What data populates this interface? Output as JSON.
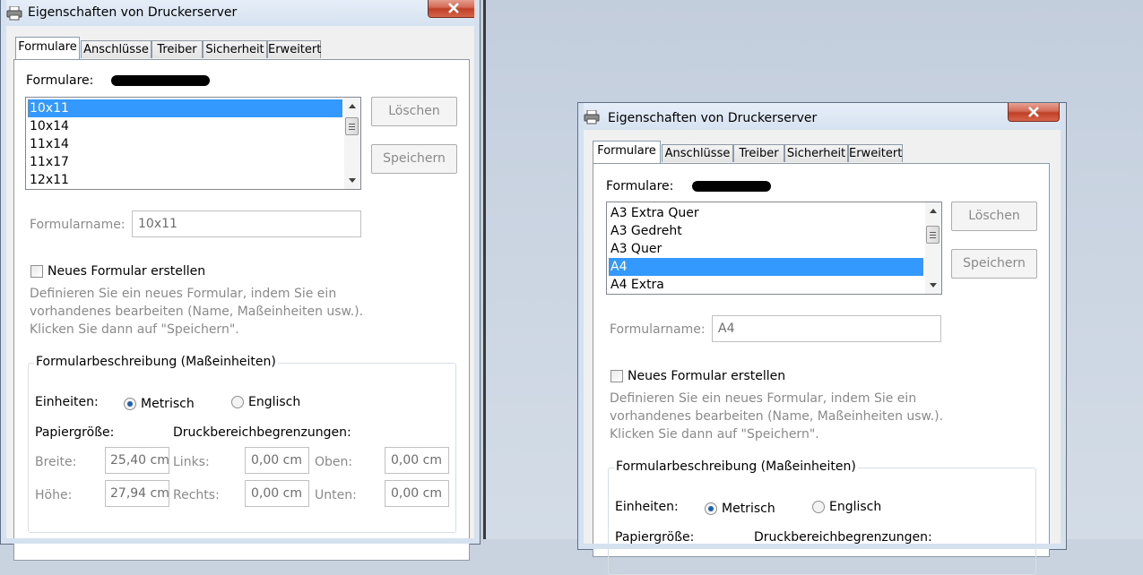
{
  "dialogs": [
    {
      "title": "Eigenschaften von Druckerserver",
      "tabs": [
        "Formulare",
        "Anschlüsse",
        "Treiber",
        "Sicherheit",
        "Erweitert"
      ],
      "active_tab": "Formulare",
      "forms_label": "Formulare:",
      "list_items": [
        "10x11",
        "10x14",
        "11x14",
        "11x17",
        "12x11"
      ],
      "selected_item": "10x11",
      "delete_label": "Löschen",
      "save_label": "Speichern",
      "form_name_label": "Formularname:",
      "form_name_value": "10x11",
      "new_form_label": "Neues Formular erstellen",
      "description": [
        "Definieren Sie ein neues Formular, indem Sie ein",
        "vorhandenes bearbeiten (Name, Maßeinheiten usw.).",
        "Klicken Sie dann auf \"Speichern\"."
      ],
      "group_label": "Formularbeschreibung (Maßeinheiten)",
      "units_label": "Einheiten:",
      "metric_label": "Metrisch",
      "english_label": "Englisch",
      "paper_size_label": "Papiergröße:",
      "print_area_label": "Druckbereichbegrenzungen:",
      "width_label": "Breite:",
      "width_value": "25,40 cm",
      "height_label": "Höhe:",
      "height_value": "27,94 cm",
      "left_label": "Links:",
      "left_value": "0,00 cm",
      "right_label": "Rechts:",
      "right_value": "0,00 cm",
      "top_label": "Oben:",
      "top_value": "0,00 cm",
      "bottom_label": "Unten:",
      "bottom_value": "0,00 cm"
    },
    {
      "title": "Eigenschaften von Druckerserver",
      "tabs": [
        "Formulare",
        "Anschlüsse",
        "Treiber",
        "Sicherheit",
        "Erweitert"
      ],
      "active_tab": "Formulare",
      "forms_label": "Formulare:",
      "list_items": [
        "A3 Extra Quer",
        "A3 Gedreht",
        "A3 Quer",
        "A4",
        "A4 Extra"
      ],
      "selected_item": "A4",
      "delete_label": "Löschen",
      "save_label": "Speichern",
      "form_name_label": "Formularname:",
      "form_name_value": "A4",
      "new_form_label": "Neues Formular erstellen",
      "description": [
        "Definieren Sie ein neues Formular, indem Sie ein",
        "vorhandenes bearbeiten (Name, Maßeinheiten usw.).",
        "Klicken Sie dann auf \"Speichern\"."
      ],
      "group_label": "Formularbeschreibung (Maßeinheiten)",
      "units_label": "Einheiten:",
      "metric_label": "Metrisch",
      "english_label": "Englisch",
      "paper_size_label": "Papiergröße:",
      "print_area_label": "Druckbereichbegrenzungen:"
    }
  ]
}
